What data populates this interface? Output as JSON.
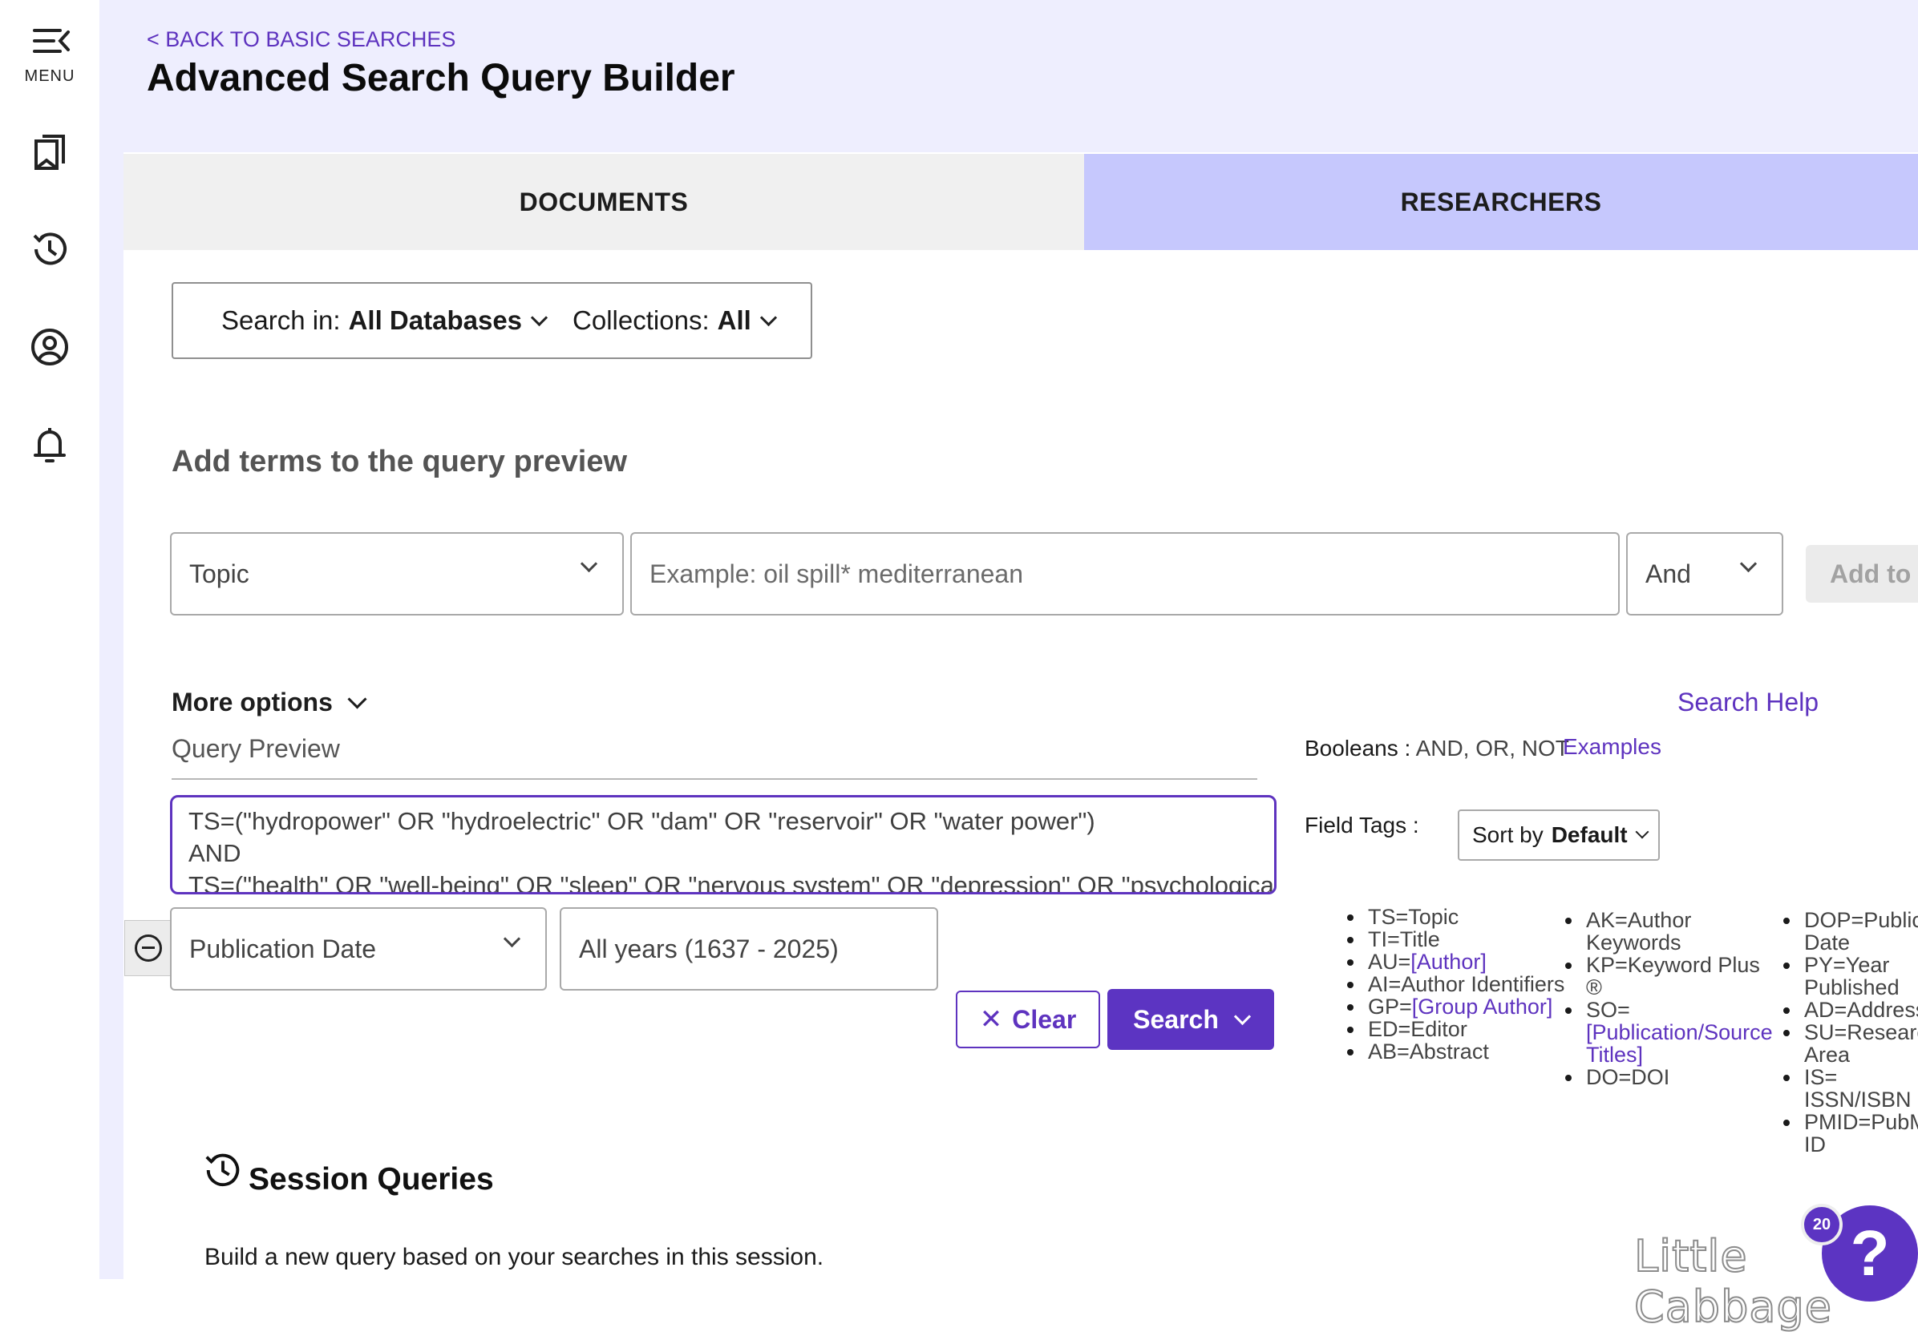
{
  "sidebar": {
    "menu_label": "MENU",
    "icons": [
      "menu-icon",
      "bookmark-icon",
      "history-icon",
      "profile-icon",
      "bell-icon"
    ]
  },
  "header": {
    "back_link": "< BACK TO BASIC SEARCHES",
    "title": "Advanced Search Query Builder"
  },
  "tabs": [
    {
      "label": "DOCUMENTS"
    },
    {
      "label": "RESEARCHERS"
    }
  ],
  "scope": {
    "search_in_label": "Search in:",
    "search_in_value": "All Databases",
    "collections_label": "Collections:",
    "collections_value": "All"
  },
  "builder": {
    "heading": "Add terms to the query preview",
    "field_value": "Topic",
    "term_placeholder": "Example: oil spill* mediterranean",
    "boolean_value": "And",
    "add_button": "Add to q"
  },
  "more_options": "More options",
  "search_help": "Search Help",
  "query_preview": {
    "label": "Query Preview",
    "lines": [
      "TS=(\"hydropower\" OR \"hydroelectric\" OR \"dam\" OR \"reservoir\" OR \"water power\")",
      "AND",
      "TS=(\"health\" OR \"well-being\" OR \"sleep\" OR \"nervous system\" OR \"depression\" OR \"psychological\""
    ]
  },
  "date_filter": {
    "field": "Publication Date",
    "range": "All years (1637 - 2025)"
  },
  "actions": {
    "clear": "Clear",
    "search": "Search"
  },
  "reference": {
    "booleans_label": "Booleans :",
    "booleans_value": "AND, OR, NOT",
    "examples": "Examples",
    "field_tags_label": "Field Tags :",
    "sort_label": "Sort by",
    "sort_value": "Default",
    "tags_col1": [
      {
        "text": "TS=Topic"
      },
      {
        "text": "TI=Title"
      },
      {
        "prefix": "AU=",
        "link": "[Author]"
      },
      {
        "text": "AI=Author Identifiers"
      },
      {
        "prefix": "GP=",
        "link": "[Group Author]"
      },
      {
        "text": "ED=Editor"
      },
      {
        "text": "AB=Abstract"
      }
    ],
    "tags_col2": [
      {
        "text": "AK=Author Keywords"
      },
      {
        "text": "KP=Keyword Plus ®"
      },
      {
        "prefix": "SO=",
        "link": "[Publication/Source Titles]"
      },
      {
        "text": "DO=DOI"
      }
    ],
    "tags_col3": [
      {
        "text": "DOP=Publication Date"
      },
      {
        "text": "PY=Year Published"
      },
      {
        "text": "AD=Address"
      },
      {
        "text": "SU=Research Area"
      },
      {
        "text": "IS= ISSN/ISBN"
      },
      {
        "text": "PMID=PubMed ID"
      }
    ]
  },
  "session": {
    "title": "Session Queries",
    "description": "Build a new query based on your searches in this session."
  },
  "help": {
    "badge": "20",
    "glyph": "?"
  },
  "watermark": "Little Cabbage",
  "colors": {
    "accent": "#5e33bf",
    "header_bg": "#eeeefe",
    "active_tab_bg": "#c6c8fd"
  }
}
